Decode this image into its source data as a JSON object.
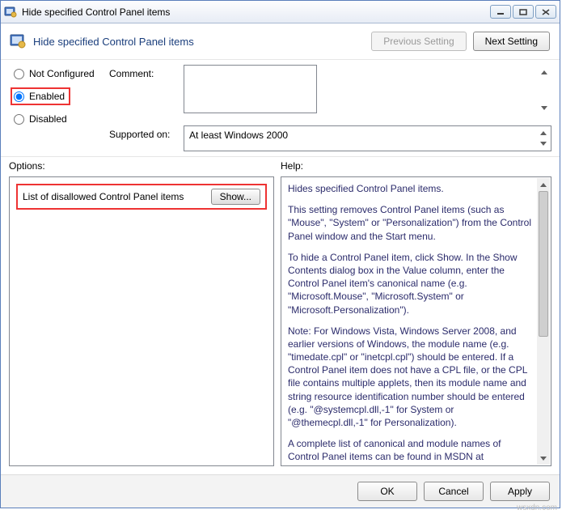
{
  "title": "Hide specified Control Panel items",
  "header": {
    "subtitle": "Hide specified Control Panel items",
    "prev_label": "Previous Setting",
    "next_label": "Next Setting"
  },
  "state": {
    "not_configured": "Not Configured",
    "enabled": "Enabled",
    "disabled": "Disabled",
    "selected": "enabled"
  },
  "meta": {
    "comment_label": "Comment:",
    "comment_value": "",
    "supported_label": "Supported on:",
    "supported_value": "At least Windows 2000"
  },
  "options": {
    "pane_label": "Options:",
    "row_label": "List of disallowed Control Panel items",
    "show_label": "Show..."
  },
  "help": {
    "pane_label": "Help:",
    "p1": "Hides specified Control Panel items.",
    "p2": "This setting removes Control Panel items (such as \"Mouse\", \"System\" or \"Personalization\") from the Control Panel window and the Start menu.",
    "p3": "To hide a Control Panel item, click Show. In the Show Contents dialog box in the Value column, enter the Control Panel item's canonical name (e.g. \"Microsoft.Mouse\", \"Microsoft.System\" or \"Microsoft.Personalization\").",
    "p4": "Note: For Windows Vista, Windows Server 2008, and earlier versions of Windows, the module name (e.g. \"timedate.cpl\" or \"inetcpl.cpl\") should be entered. If a Control Panel item does not have a CPL file, or the CPL file contains multiple applets, then its module name and string resource identification number should be entered (e.g. \"@systemcpl.dll,-1\" for System or \"@themecpl.dll,-1\" for Personalization).",
    "p5": "A complete list of canonical and module names of Control Panel items can be found in MSDN at"
  },
  "footer": {
    "ok": "OK",
    "cancel": "Cancel",
    "apply": "Apply"
  },
  "watermark": "wsxdn.com"
}
